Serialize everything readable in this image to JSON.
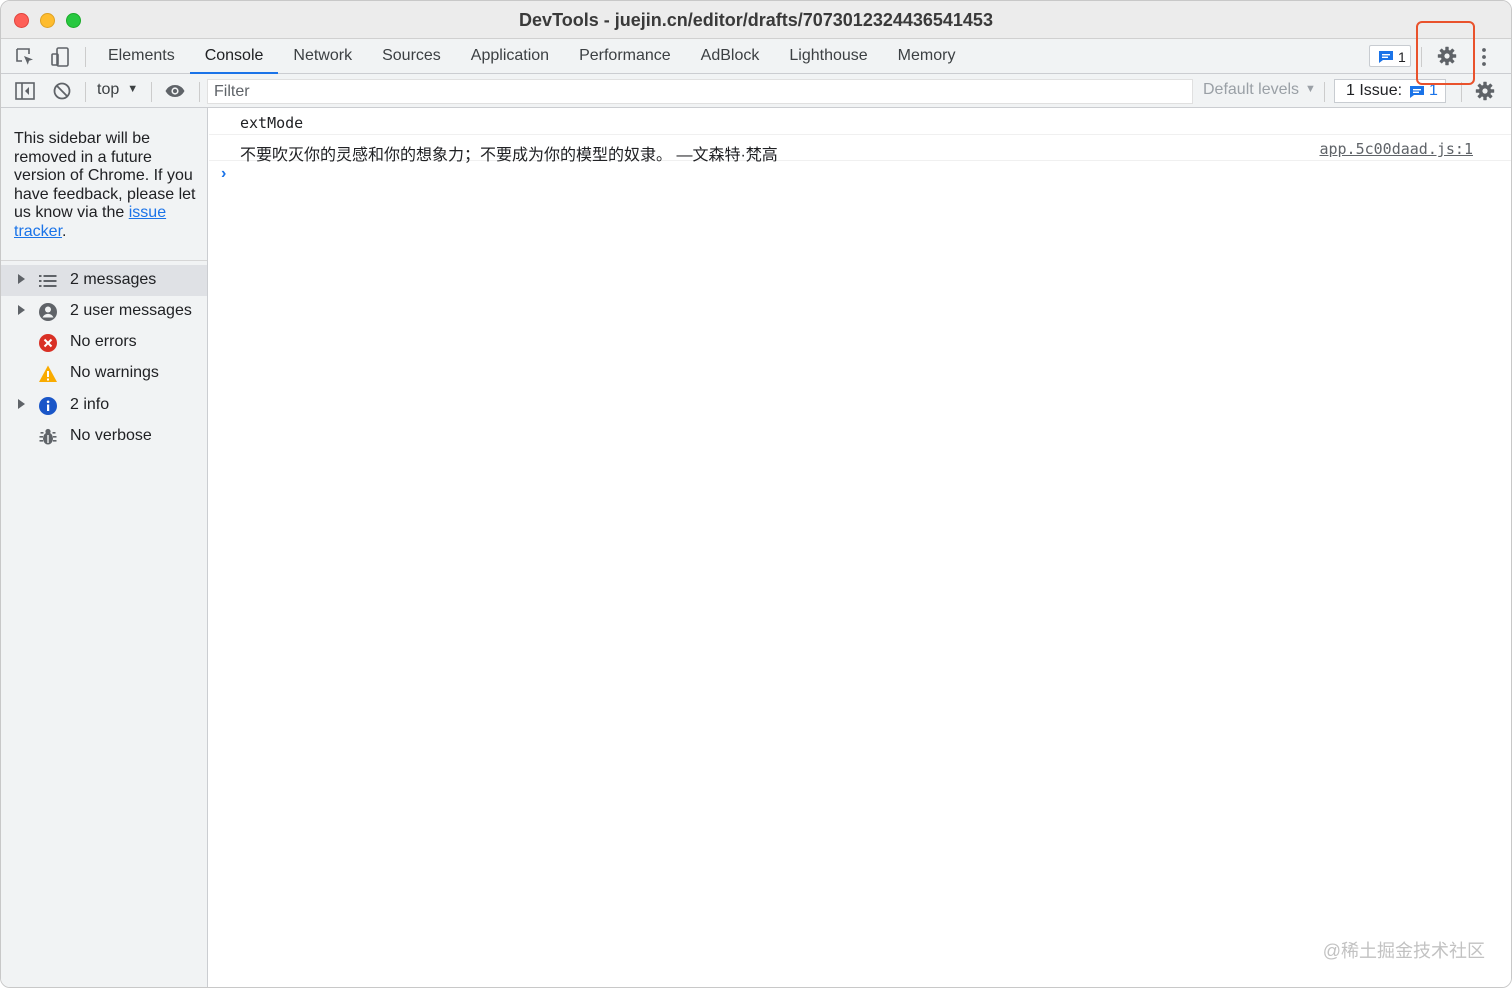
{
  "window": {
    "title": "DevTools - juejin.cn/editor/drafts/7073012324436541453"
  },
  "tabbar": {
    "tabs": [
      {
        "label": "Elements"
      },
      {
        "label": "Console"
      },
      {
        "label": "Network"
      },
      {
        "label": "Sources"
      },
      {
        "label": "Application"
      },
      {
        "label": "Performance"
      },
      {
        "label": "AdBlock"
      },
      {
        "label": "Lighthouse"
      },
      {
        "label": "Memory"
      }
    ],
    "active_tab": "Console",
    "message_count": "1"
  },
  "console_toolbar": {
    "context": "top",
    "filter_placeholder": "Filter",
    "levels": "Default levels",
    "issues_label": "1 Issue:",
    "issues_count": "1"
  },
  "sidebar": {
    "deprecation_text": "This sidebar will be removed in a future version of Chrome. If you have feedback, please let us know via the",
    "deprecation_link_1": "issue",
    "deprecation_link_2": "tracker",
    "deprecation_end": ".",
    "items": [
      {
        "label": "2 messages",
        "icon": "list-icon",
        "expandable": true
      },
      {
        "label": "2 user messages",
        "icon": "user-icon",
        "expandable": true
      },
      {
        "label": "No errors",
        "icon": "error-icon",
        "expandable": false
      },
      {
        "label": "No warnings",
        "icon": "warning-icon",
        "expandable": false
      },
      {
        "label": "2 info",
        "icon": "info-icon",
        "expandable": true
      },
      {
        "label": "No verbose",
        "icon": "bug-icon",
        "expandable": false
      }
    ]
  },
  "console": {
    "messages": [
      {
        "text": "extMode",
        "source": ""
      },
      {
        "text": "不要吹灭你的灵感和你的想象力；不要成为你的模型的奴隶。 —文森特·梵高",
        "source": "app.5c00daad.js:1"
      }
    ],
    "prompt": "›"
  },
  "watermark": "@稀土掘金技术社区",
  "colors": {
    "accent": "#1a73e8",
    "highlight": "#e9522c",
    "error": "#d93025",
    "warning": "#f9ab00"
  }
}
